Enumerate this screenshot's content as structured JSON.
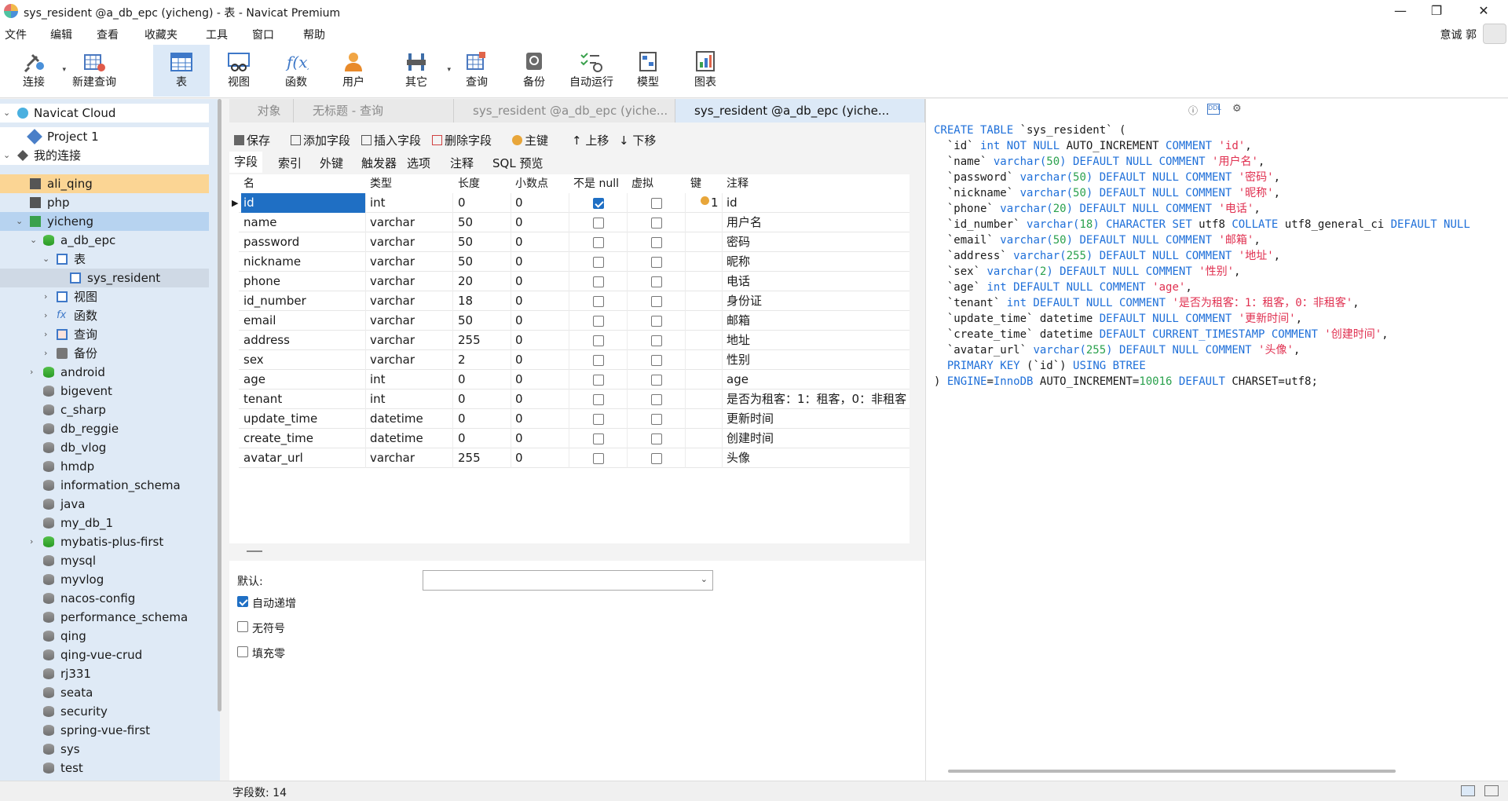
{
  "window": {
    "title": "sys_resident @a_db_epc (yicheng) - 表 - Navicat Premium",
    "minimize": "—",
    "maximize": "❐",
    "close": "✕"
  },
  "menu": [
    "文件",
    "编辑",
    "查看",
    "收藏夹",
    "工具",
    "窗口",
    "帮助"
  ],
  "user": {
    "name": "意诚 郭"
  },
  "toolbar": [
    "连接",
    "新建查询",
    "表",
    "视图",
    "函数",
    "用户",
    "其它",
    "查询",
    "备份",
    "自动运行",
    "模型",
    "图表"
  ],
  "tree": {
    "cloud": "Navicat Cloud",
    "project": "Project 1",
    "myconn": "我的连接",
    "conns": [
      "ali_qing",
      "php",
      "yicheng"
    ],
    "db": "a_db_epc",
    "tables": "表",
    "table": "sys_resident",
    "views": "视图",
    "funcs": "函数",
    "queries": "查询",
    "backups": "备份",
    "dbs": [
      "android",
      "bigevent",
      "c_sharp",
      "db_reggie",
      "db_vlog",
      "hmdp",
      "information_schema",
      "java",
      "my_db_1",
      "mybatis-plus-first",
      "mysql",
      "myvlog",
      "nacos-config",
      "performance_schema",
      "qing",
      "qing-vue-crud",
      "rj331",
      "seata",
      "security",
      "spring-vue-first",
      "sys",
      "test"
    ]
  },
  "tabs": [
    "对象",
    "无标题 - 查询",
    "sys_resident @a_db_epc (yiche...",
    "sys_resident @a_db_epc (yiche..."
  ],
  "editor_toolbar": [
    "保存",
    "添加字段",
    "插入字段",
    "删除字段",
    "主键",
    "上移",
    "下移"
  ],
  "subtabs": [
    "字段",
    "索引",
    "外键",
    "触发器",
    "选项",
    "注释",
    "SQL 预览"
  ],
  "grid": {
    "headers": [
      "名",
      "类型",
      "长度",
      "小数点",
      "不是 null",
      "虚拟",
      "键",
      "注释"
    ],
    "rows": [
      {
        "name": "id",
        "type": "int",
        "len": "0",
        "dec": "0",
        "notnull": true,
        "key": "1",
        "comment": "id"
      },
      {
        "name": "name",
        "type": "varchar",
        "len": "50",
        "dec": "0",
        "notnull": false,
        "key": "",
        "comment": "用户名"
      },
      {
        "name": "password",
        "type": "varchar",
        "len": "50",
        "dec": "0",
        "notnull": false,
        "key": "",
        "comment": "密码"
      },
      {
        "name": "nickname",
        "type": "varchar",
        "len": "50",
        "dec": "0",
        "notnull": false,
        "key": "",
        "comment": "昵称"
      },
      {
        "name": "phone",
        "type": "varchar",
        "len": "20",
        "dec": "0",
        "notnull": false,
        "key": "",
        "comment": "电话"
      },
      {
        "name": "id_number",
        "type": "varchar",
        "len": "18",
        "dec": "0",
        "notnull": false,
        "key": "",
        "comment": "身份证"
      },
      {
        "name": "email",
        "type": "varchar",
        "len": "50",
        "dec": "0",
        "notnull": false,
        "key": "",
        "comment": "邮箱"
      },
      {
        "name": "address",
        "type": "varchar",
        "len": "255",
        "dec": "0",
        "notnull": false,
        "key": "",
        "comment": "地址"
      },
      {
        "name": "sex",
        "type": "varchar",
        "len": "2",
        "dec": "0",
        "notnull": false,
        "key": "",
        "comment": "性别"
      },
      {
        "name": "age",
        "type": "int",
        "len": "0",
        "dec": "0",
        "notnull": false,
        "key": "",
        "comment": "age"
      },
      {
        "name": "tenant",
        "type": "int",
        "len": "0",
        "dec": "0",
        "notnull": false,
        "key": "",
        "comment": "是否为租客：1：租客，0：非租客"
      },
      {
        "name": "update_time",
        "type": "datetime",
        "len": "0",
        "dec": "0",
        "notnull": false,
        "key": "",
        "comment": "更新时间"
      },
      {
        "name": "create_time",
        "type": "datetime",
        "len": "0",
        "dec": "0",
        "notnull": false,
        "key": "",
        "comment": "创建时间"
      },
      {
        "name": "avatar_url",
        "type": "varchar",
        "len": "255",
        "dec": "0",
        "notnull": false,
        "key": "",
        "comment": "头像"
      }
    ]
  },
  "props": {
    "default_label": "默认:",
    "auto_inc": "自动递增",
    "auto_inc_checked": true,
    "unsigned": "无符号",
    "zerofill": "填充零"
  },
  "ddl": [
    [
      [
        "CREATE TABLE ",
        "kw"
      ],
      [
        "`sys_resident` (",
        ""
      ]
    ],
    [
      [
        "  `id` ",
        ""
      ],
      [
        "int NOT NULL ",
        "kw"
      ],
      [
        "AUTO_INCREMENT ",
        ""
      ],
      [
        "COMMENT ",
        "kw"
      ],
      [
        "'id'",
        "str"
      ],
      [
        ",",
        ""
      ]
    ],
    [
      [
        "  `name` ",
        ""
      ],
      [
        "varchar(",
        "kw"
      ],
      [
        "50",
        "num"
      ],
      [
        ") DEFAULT NULL COMMENT ",
        "kw"
      ],
      [
        "'用户名'",
        "str"
      ],
      [
        ",",
        ""
      ]
    ],
    [
      [
        "  `password` ",
        ""
      ],
      [
        "varchar(",
        "kw"
      ],
      [
        "50",
        "num"
      ],
      [
        ") DEFAULT NULL COMMENT ",
        "kw"
      ],
      [
        "'密码'",
        "str"
      ],
      [
        ",",
        ""
      ]
    ],
    [
      [
        "  `nickname` ",
        ""
      ],
      [
        "varchar(",
        "kw"
      ],
      [
        "50",
        "num"
      ],
      [
        ") DEFAULT NULL COMMENT ",
        "kw"
      ],
      [
        "'昵称'",
        "str"
      ],
      [
        ",",
        ""
      ]
    ],
    [
      [
        "  `phone` ",
        ""
      ],
      [
        "varchar(",
        "kw"
      ],
      [
        "20",
        "num"
      ],
      [
        ") DEFAULT NULL COMMENT ",
        "kw"
      ],
      [
        "'电话'",
        "str"
      ],
      [
        ",",
        ""
      ]
    ],
    [
      [
        "  `id_number` ",
        ""
      ],
      [
        "varchar(",
        "kw"
      ],
      [
        "18",
        "num"
      ],
      [
        ") CHARACTER SET ",
        "kw"
      ],
      [
        "utf8 ",
        ""
      ],
      [
        "COLLATE ",
        "kw"
      ],
      [
        "utf8_general_ci ",
        ""
      ],
      [
        "DEFAULT NULL",
        "kw"
      ]
    ],
    [
      [
        "  `email` ",
        ""
      ],
      [
        "varchar(",
        "kw"
      ],
      [
        "50",
        "num"
      ],
      [
        ") DEFAULT NULL COMMENT ",
        "kw"
      ],
      [
        "'邮箱'",
        "str"
      ],
      [
        ",",
        ""
      ]
    ],
    [
      [
        "  `address` ",
        ""
      ],
      [
        "varchar(",
        "kw"
      ],
      [
        "255",
        "num"
      ],
      [
        ") DEFAULT NULL COMMENT ",
        "kw"
      ],
      [
        "'地址'",
        "str"
      ],
      [
        ",",
        ""
      ]
    ],
    [
      [
        "  `sex` ",
        ""
      ],
      [
        "varchar(",
        "kw"
      ],
      [
        "2",
        "num"
      ],
      [
        ") DEFAULT NULL COMMENT ",
        "kw"
      ],
      [
        "'性别'",
        "str"
      ],
      [
        ",",
        ""
      ]
    ],
    [
      [
        "  `age` ",
        ""
      ],
      [
        "int DEFAULT NULL COMMENT ",
        "kw"
      ],
      [
        "'age'",
        "str"
      ],
      [
        ",",
        ""
      ]
    ],
    [
      [
        "  `tenant` ",
        ""
      ],
      [
        "int DEFAULT NULL COMMENT ",
        "kw"
      ],
      [
        "'是否为租客：1：租客，0：非租客'",
        "str"
      ],
      [
        ",",
        ""
      ]
    ],
    [
      [
        "  `update_time` ",
        ""
      ],
      [
        "datetime ",
        ""
      ],
      [
        "DEFAULT NULL COMMENT ",
        "kw"
      ],
      [
        "'更新时间'",
        "str"
      ],
      [
        ",",
        ""
      ]
    ],
    [
      [
        "  `create_time` ",
        ""
      ],
      [
        "datetime ",
        ""
      ],
      [
        "DEFAULT CURRENT_TIMESTAMP COMMENT ",
        "kw"
      ],
      [
        "'创建时间'",
        "str"
      ],
      [
        ",",
        ""
      ]
    ],
    [
      [
        "  `avatar_url` ",
        ""
      ],
      [
        "varchar(",
        "kw"
      ],
      [
        "255",
        "num"
      ],
      [
        ") DEFAULT NULL COMMENT ",
        "kw"
      ],
      [
        "'头像'",
        "str"
      ],
      [
        ",",
        ""
      ]
    ],
    [
      [
        "  PRIMARY KEY ",
        "kw"
      ],
      [
        "(`id`) ",
        ""
      ],
      [
        "USING BTREE",
        "kw"
      ]
    ],
    [
      [
        ") ",
        ""
      ],
      [
        "ENGINE",
        "kw"
      ],
      [
        "=",
        ""
      ],
      [
        "InnoDB ",
        "kw"
      ],
      [
        "AUTO_INCREMENT=",
        ""
      ],
      [
        "10016 ",
        "num"
      ],
      [
        "DEFAULT ",
        "kw"
      ],
      [
        "CHARSET=utf8;",
        ""
      ]
    ]
  ],
  "status": {
    "field_count": "字段数: 14"
  }
}
